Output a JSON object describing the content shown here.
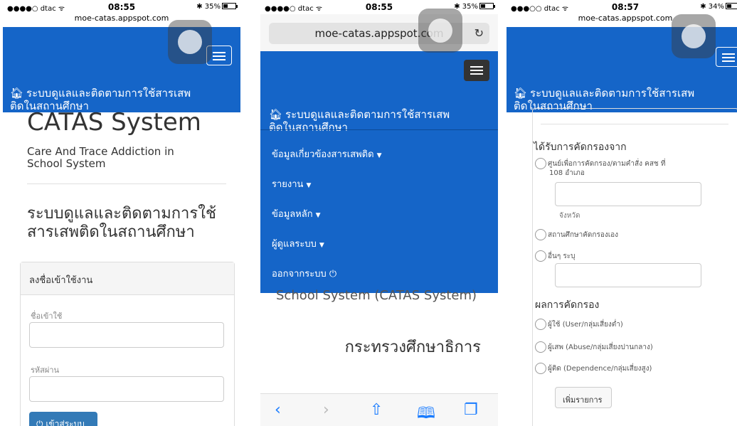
{
  "phone1": {
    "status": {
      "carrier": "●●●●○ dtac ᯤ",
      "time": "08:55",
      "battery": "35%",
      "battery_fill": 0.35
    },
    "url": "moe-catas.appspot.com",
    "brand_line1": "ระบบดูแลและติดตามการใช้สารเสพ",
    "brand_line2": "ติดในสถานศึกษา",
    "title": "CATAS System",
    "subtitle_line1": "Care And Trace Addiction in",
    "subtitle_line2": "School System",
    "thai_heading_line1": "ระบบดูแลและติดตามการใช้",
    "thai_heading_line2": "สารเสพติดในสถานศึกษา",
    "login_header": "ลงชื่อเข้าใช้งาน",
    "username_label": "ชื่อเข้าใช้",
    "password_label": "รหัสผ่าน",
    "login_button": "เข้าสู่ระบบ"
  },
  "phone2": {
    "status": {
      "carrier": "●●●●○ dtac ᯤ",
      "time": "08:55",
      "battery": "35%",
      "battery_fill": 0.35
    },
    "url": "moe-catas.appspot.com",
    "brand_line1": "ระบบดูแลและติดตามการใช้สารเสพ",
    "brand_line2": "ติดในสถานศึกษา",
    "menu": [
      {
        "label": "ข้อมูลเกี่ยวข้องสารเสพติด",
        "caret": "▼"
      },
      {
        "label": "รายงาน",
        "caret": "▼"
      },
      {
        "label": "ข้อมูลหลัก",
        "caret": "▼"
      },
      {
        "label": "ผู้ดูแลระบบ",
        "caret": "▼"
      },
      {
        "label": "ออกจากระบบ",
        "caret": "⏻"
      }
    ],
    "behind_text": "School System (CATAS System)",
    "ministry": "กระทรวงศึกษาธิการ",
    "toolbar_icons": [
      "back-icon",
      "forward-icon",
      "share-icon",
      "bookmarks-icon",
      "tabs-icon"
    ]
  },
  "phone3": {
    "status": {
      "carrier": "●●●○○ dtac ᯤ",
      "time": "08:57",
      "battery": "34%",
      "battery_fill": 0.34
    },
    "url": "moe-catas.appspot.com",
    "brand_line1": "ระบบดูแลและติดตามการใช้สารเสพ",
    "brand_line2": "ติดในสถานศึกษา",
    "screening_title": "ได้รับการคัดกรองจาก",
    "opt1_line1": "ศูนย์เพื่อการคัดกรอง/ตามคำสั่ง คสช ที่",
    "opt1_line2": "108 อำเภอ",
    "province_label": "จังหวัด",
    "opt2": "สถานศึกษาคัดกรองเอง",
    "opt3": "อื่นๆ ระบุ",
    "result_title": "ผลการคัดกรอง",
    "result_opts": [
      "ผู้ใช้ (User/กลุ่มเสี่ยงต่ำ)",
      "ผู้เสพ (Abuse/กลุ่มเสี่ยงปานกลาง)",
      "ผู้ติด (Dependence/กลุ่มเสี่ยงสูง)"
    ],
    "add_button": "เพิ่มรายการ"
  }
}
